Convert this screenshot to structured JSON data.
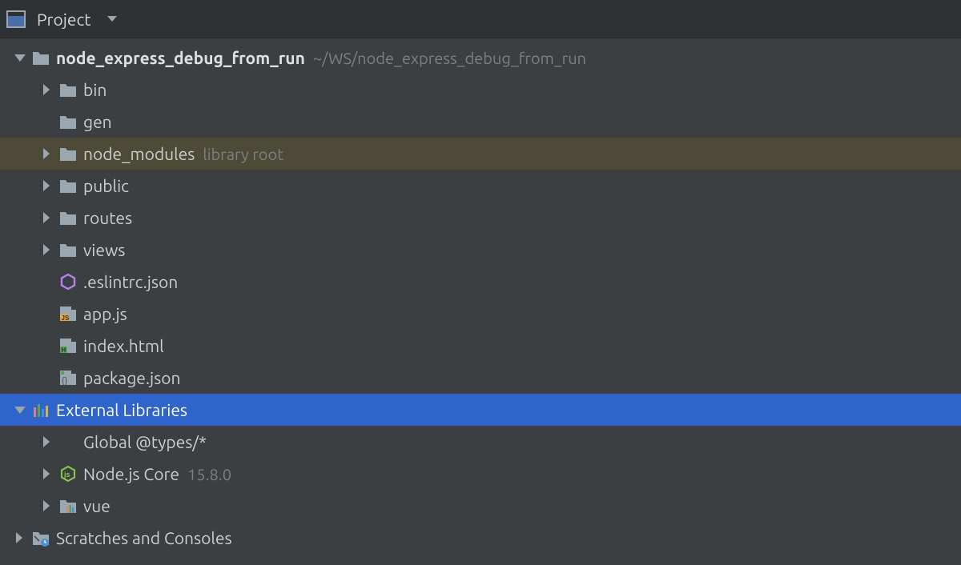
{
  "toolbar": {
    "title": "Project"
  },
  "tree": {
    "root": {
      "name": "node_express_debug_from_run",
      "path": "~/WS/node_express_debug_from_run"
    },
    "children": [
      {
        "kind": "folder",
        "name": "bin",
        "expandable": true
      },
      {
        "kind": "folder",
        "name": "gen",
        "expandable": false
      },
      {
        "kind": "folder",
        "name": "node_modules",
        "expandable": true,
        "annot": "library root",
        "library_root": true
      },
      {
        "kind": "folder",
        "name": "public",
        "expandable": true
      },
      {
        "kind": "folder",
        "name": "routes",
        "expandable": true
      },
      {
        "kind": "folder",
        "name": "views",
        "expandable": true
      },
      {
        "kind": "eslint",
        "name": ".eslintrc.json"
      },
      {
        "kind": "js",
        "name": "app.js"
      },
      {
        "kind": "html",
        "name": "index.html"
      },
      {
        "kind": "pkgjson",
        "name": "package.json"
      }
    ],
    "ext_lib": {
      "title": "External Libraries"
    },
    "ext_children": [
      {
        "kind": "none",
        "name": "Global @types/*",
        "expandable": true
      },
      {
        "kind": "nodejs",
        "name": "Node.js Core",
        "annot": "15.8.0",
        "expandable": true
      },
      {
        "kind": "libfolder",
        "name": "vue",
        "expandable": true
      }
    ],
    "scratches": {
      "title": "Scratches and Consoles"
    }
  }
}
